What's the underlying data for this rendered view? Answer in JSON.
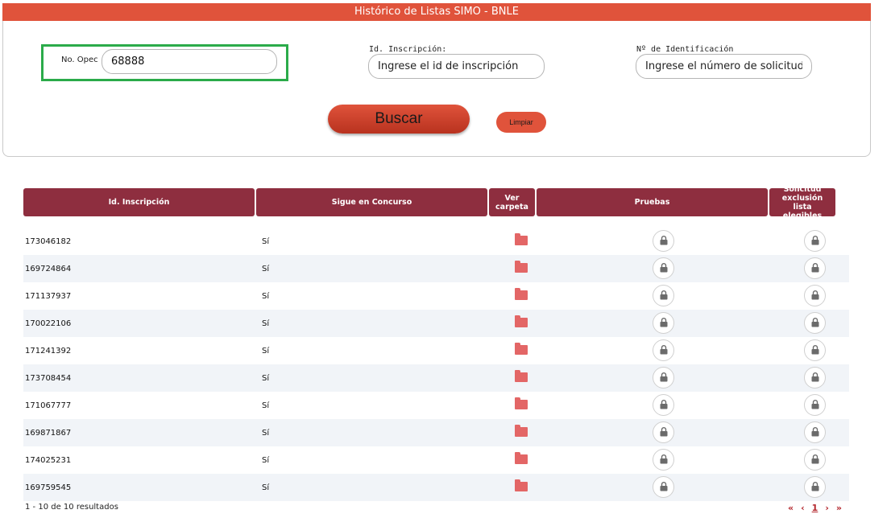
{
  "header": {
    "title": "Histórico de Listas SIMO - BNLE"
  },
  "form": {
    "opec_label": "No. Opec",
    "opec_value": "68888",
    "inscripcion_label": "Id. Inscripción:",
    "inscripcion_placeholder": "Ingrese el id de inscripción",
    "identificacion_label": "Nº de Identificación",
    "identificacion_placeholder": "Ingrese el número de solicitud",
    "buscar_label": "Buscar",
    "limpiar_label": "Limpiar"
  },
  "table": {
    "headers": {
      "id": "Id. Inscripción",
      "sigue": "Sigue en Concurso",
      "carpeta": "Ver carpeta",
      "pruebas": "Pruebas",
      "solicitud": "Solicitud exclusión lista elegibles"
    },
    "rows": [
      {
        "id": "173046182",
        "sigue": "Sí"
      },
      {
        "id": "169724864",
        "sigue": "Sí"
      },
      {
        "id": "171137937",
        "sigue": "Sí"
      },
      {
        "id": "170022106",
        "sigue": "Sí"
      },
      {
        "id": "171241392",
        "sigue": "Sí"
      },
      {
        "id": "173708454",
        "sigue": "Sí"
      },
      {
        "id": "171067777",
        "sigue": "Sí"
      },
      {
        "id": "169871867",
        "sigue": "Sí"
      },
      {
        "id": "174025231",
        "sigue": "Sí"
      },
      {
        "id": "169759545",
        "sigue": "Sí"
      }
    ]
  },
  "footer": {
    "results_text": "1 - 10 de 10 resultados",
    "pager": {
      "first": "«",
      "prev": "‹",
      "current": "1",
      "next": "›",
      "last": "»"
    }
  },
  "icons": {
    "folder": "folder-icon",
    "lock": "lock-icon"
  },
  "colors": {
    "accent": "#e0533b",
    "header": "#8e2e3f",
    "highlight": "#2bab4a"
  }
}
